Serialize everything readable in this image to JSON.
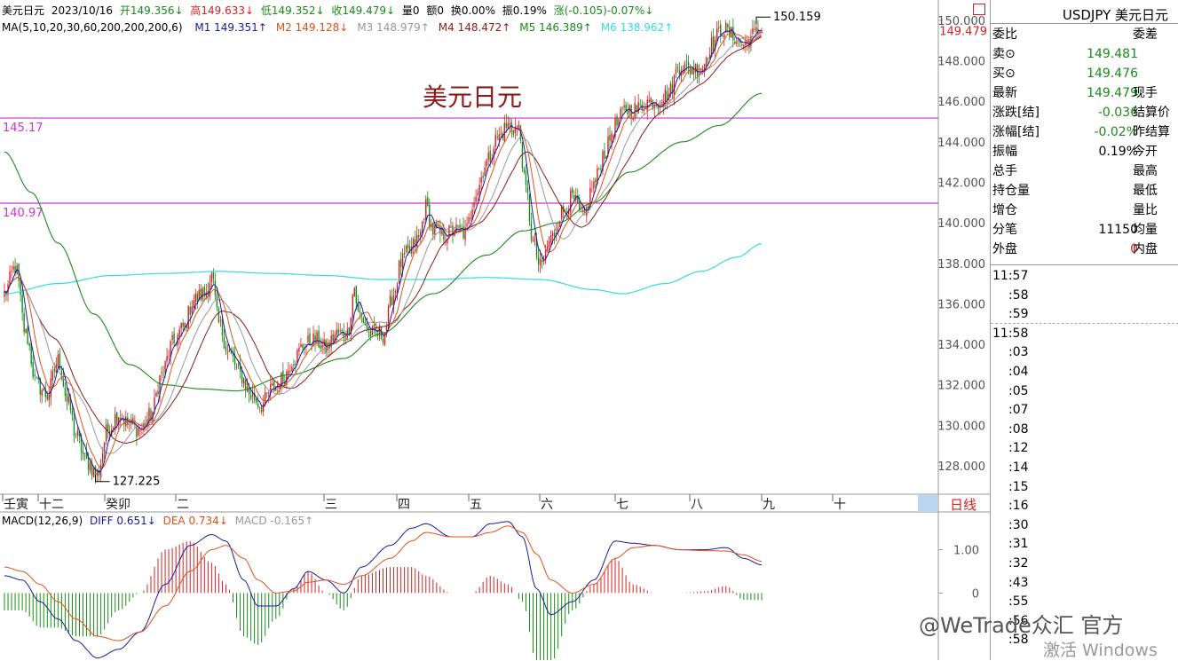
{
  "header": {
    "symbol_name": "美元日元",
    "date": "2023/10/16",
    "open": "开149.356↓",
    "high": "高149.633↓",
    "low": "低149.352↓",
    "close": "收149.479↓",
    "volume": "量0",
    "amount": "额0",
    "turnover": "换0.00%",
    "amplitude": "振0.19%",
    "change": "涨(-0.105)-0.07%↓"
  },
  "ma_legend": {
    "label": "MA(5,10,20,30,60,200,200,200,6)",
    "items": [
      {
        "text": "M1 149.351↑",
        "color": "#1a1aa0"
      },
      {
        "text": "M2 149.128↓",
        "color": "#e0501a"
      },
      {
        "text": "M3 148.979↑",
        "color": "#999999"
      },
      {
        "text": "M4 148.472↑",
        "color": "#8b1a1a"
      },
      {
        "text": "M5 146.389↑",
        "color": "#1a8a1a"
      },
      {
        "text": "M6 138.962↑",
        "color": "#33dddd"
      }
    ]
  },
  "chart_title_overlay": "美元日元",
  "hline_labels": [
    "145.17",
    "140.97"
  ],
  "max_label": "150.159",
  "min_label": "127.225",
  "last_price_label": "149.479",
  "period_label": "日线",
  "macd_legend": {
    "label": "MACD(12,26,9)",
    "diff": "DIFF 0.651↓",
    "dea": "DEA 0.734↓",
    "macd": "MACD -0.165↑"
  },
  "colors": {
    "up": "#d42020",
    "down": "#1a8a1a",
    "hline": "#cc33cc",
    "ma5": "#1a1aa0",
    "ma10": "#e0501a",
    "ma20": "#999999",
    "ma30": "#8b1a1a",
    "ma60": "#1a8a1a",
    "ma200": "#33dddd"
  },
  "right_panel": {
    "title": "USDJPY 美元日元",
    "rows": [
      {
        "label": "委比",
        "value": "",
        "right": "委差"
      },
      {
        "label": "卖⊙",
        "value": "149.481",
        "right": "",
        "color": "#1a8a1a"
      },
      {
        "label": "买⊙",
        "value": "149.476",
        "right": "",
        "color": "#1a8a1a"
      },
      {
        "label": "最新",
        "value": "149.479",
        "right": "现手",
        "color": "#1a8a1a"
      },
      {
        "label": "涨跌[结]",
        "value": "-0.036",
        "right": "结算价",
        "color": "#1a8a1a"
      },
      {
        "label": "涨幅[结]",
        "value": "-0.02%",
        "right": "昨结算",
        "color": "#1a8a1a"
      },
      {
        "label": "振幅",
        "value": "0.19%",
        "right": "今开",
        "color": "#000"
      },
      {
        "label": "总手",
        "value": "",
        "right": "最高"
      },
      {
        "label": "持仓量",
        "value": "",
        "right": "最低"
      },
      {
        "label": "增仓",
        "value": "",
        "right": "量比"
      },
      {
        "label": "分笔",
        "value": "11150",
        "right": "均量",
        "color": "#000"
      },
      {
        "label": "外盘",
        "value": "0",
        "right": "内盘",
        "color": "#d42020"
      }
    ],
    "ticks": [
      "11:57",
      ":58",
      ":59",
      "11:58",
      ":03",
      ":04",
      ":05",
      ":07",
      ":08",
      ":12",
      ":14",
      ":15",
      ":16",
      ":30",
      ":31",
      ":32",
      ":43",
      ":55",
      ":56",
      ":58"
    ]
  },
  "watermark": {
    "line1": "@WeTrade众汇 官方",
    "line2": "激活 Windows"
  },
  "chart_data": [
    {
      "type": "candlestick",
      "title": "美元日元",
      "y_axis_ticks": [
        "150.000",
        "148.000",
        "146.000",
        "144.000",
        "142.000",
        "140.000",
        "138.000",
        "136.000",
        "134.000",
        "132.000",
        "130.000",
        "128.000"
      ],
      "ylim": [
        126.6,
        151.0
      ],
      "x_axis_labels": [
        "壬寅",
        "十二",
        "癸卯",
        "二",
        "三",
        "四",
        "五",
        "六",
        "七",
        "八",
        "九",
        "十"
      ],
      "horizontal_lines": [
        145.17,
        140.97
      ],
      "max_point": 150.159,
      "min_point": 127.225,
      "anchors": [
        [
          0,
          136.5
        ],
        [
          6,
          137.8
        ],
        [
          12,
          134.5
        ],
        [
          18,
          132.0
        ],
        [
          24,
          131.5
        ],
        [
          30,
          133.2
        ],
        [
          36,
          131.0
        ],
        [
          40,
          129.5
        ],
        [
          46,
          128.2
        ],
        [
          52,
          127.6
        ],
        [
          58,
          129.8
        ],
        [
          64,
          130.6
        ],
        [
          70,
          130.0
        ],
        [
          76,
          129.8
        ],
        [
          82,
          130.5
        ],
        [
          88,
          132.5
        ],
        [
          94,
          134.0
        ],
        [
          100,
          134.8
        ],
        [
          106,
          136.2
        ],
        [
          112,
          136.5
        ],
        [
          116,
          137.3
        ],
        [
          120,
          135.0
        ],
        [
          126,
          133.5
        ],
        [
          132,
          132.5
        ],
        [
          138,
          131.5
        ],
        [
          144,
          131.0
        ],
        [
          150,
          131.8
        ],
        [
          156,
          132.3
        ],
        [
          162,
          133.3
        ],
        [
          168,
          134.0
        ],
        [
          174,
          134.2
        ],
        [
          180,
          133.8
        ],
        [
          186,
          134.5
        ],
        [
          192,
          134.5
        ],
        [
          196,
          136.8
        ],
        [
          198,
          135.5
        ],
        [
          206,
          134.5
        ],
        [
          212,
          134.5
        ],
        [
          218,
          136.5
        ],
        [
          222,
          138.0
        ],
        [
          226,
          138.5
        ],
        [
          232,
          139.2
        ],
        [
          236,
          140.8
        ],
        [
          240,
          139.6
        ],
        [
          246,
          139.4
        ],
        [
          252,
          139.6
        ],
        [
          258,
          139.5
        ],
        [
          264,
          141.5
        ],
        [
          270,
          143.0
        ],
        [
          276,
          144.2
        ],
        [
          282,
          144.8
        ],
        [
          288,
          144.6
        ],
        [
          292,
          141.6
        ],
        [
          296,
          139.0
        ],
        [
          300,
          137.8
        ],
        [
          306,
          139.2
        ],
        [
          312,
          140.5
        ],
        [
          318,
          141.2
        ],
        [
          324,
          140.2
        ],
        [
          330,
          141.9
        ],
        [
          336,
          143.5
        ],
        [
          342,
          144.8
        ],
        [
          348,
          145.6
        ],
        [
          354,
          145.6
        ],
        [
          360,
          146.0
        ],
        [
          366,
          146.0
        ],
        [
          372,
          146.4
        ],
        [
          378,
          147.8
        ],
        [
          384,
          147.6
        ],
        [
          390,
          147.6
        ],
        [
          396,
          148.8
        ],
        [
          402,
          149.6
        ],
        [
          408,
          149.2
        ],
        [
          414,
          148.8
        ],
        [
          420,
          149.3
        ],
        [
          424,
          149.48
        ]
      ],
      "ma200_anchors": [
        [
          0,
          136.5
        ],
        [
          30,
          137.0
        ],
        [
          60,
          137.4
        ],
        [
          90,
          137.5
        ],
        [
          120,
          137.6
        ],
        [
          150,
          137.5
        ],
        [
          180,
          137.4
        ],
        [
          210,
          137.2
        ],
        [
          240,
          137.2
        ],
        [
          270,
          137.3
        ],
        [
          300,
          137.2
        ],
        [
          330,
          136.7
        ],
        [
          346,
          136.5
        ],
        [
          370,
          137.0
        ],
        [
          390,
          137.6
        ],
        [
          410,
          138.3
        ],
        [
          424,
          138.962
        ]
      ],
      "ma60_anchors": [
        [
          0,
          143.5
        ],
        [
          15,
          141.5
        ],
        [
          30,
          139.0
        ],
        [
          50,
          135.5
        ],
        [
          70,
          133.0
        ],
        [
          90,
          132.0
        ],
        [
          110,
          131.8
        ],
        [
          130,
          131.7
        ],
        [
          160,
          132.5
        ],
        [
          190,
          133.3
        ],
        [
          210,
          134.5
        ],
        [
          240,
          136.5
        ],
        [
          270,
          138.4
        ],
        [
          290,
          139.6
        ],
        [
          310,
          140.0
        ],
        [
          330,
          141.0
        ],
        [
          350,
          142.5
        ],
        [
          380,
          144.0
        ],
        [
          400,
          144.8
        ],
        [
          424,
          146.389
        ]
      ]
    },
    {
      "type": "bar",
      "title": "MACD(12,26,9)",
      "y_axis_ticks": [
        "1.00",
        "0"
      ],
      "ylim": [
        -1.55,
        1.75
      ],
      "diff_anchors": [
        [
          0,
          0.4
        ],
        [
          10,
          0.3
        ],
        [
          20,
          -0.2
        ],
        [
          30,
          -0.6
        ],
        [
          40,
          -1.1
        ],
        [
          52,
          -1.5
        ],
        [
          64,
          -1.3
        ],
        [
          76,
          -0.9
        ],
        [
          90,
          0.2
        ],
        [
          104,
          1.1
        ],
        [
          116,
          1.35
        ],
        [
          124,
          1.2
        ],
        [
          134,
          0.3
        ],
        [
          142,
          -0.3
        ],
        [
          152,
          -0.3
        ],
        [
          162,
          0.1
        ],
        [
          170,
          0.5
        ],
        [
          180,
          0.3
        ],
        [
          190,
          0.0
        ],
        [
          200,
          0.6
        ],
        [
          216,
          1.1
        ],
        [
          228,
          1.5
        ],
        [
          236,
          1.6
        ],
        [
          250,
          1.3
        ],
        [
          262,
          1.3
        ],
        [
          272,
          1.6
        ],
        [
          282,
          1.65
        ],
        [
          290,
          1.3
        ],
        [
          298,
          0.1
        ],
        [
          306,
          -0.5
        ],
        [
          318,
          -0.2
        ],
        [
          330,
          0.3
        ],
        [
          342,
          1.2
        ],
        [
          352,
          1.15
        ],
        [
          364,
          1.1
        ],
        [
          378,
          1.0
        ],
        [
          392,
          1.0
        ],
        [
          404,
          1.05
        ],
        [
          414,
          0.8
        ],
        [
          424,
          0.651
        ]
      ],
      "dea_anchors": [
        [
          0,
          0.6
        ],
        [
          10,
          0.5
        ],
        [
          20,
          0.2
        ],
        [
          30,
          -0.2
        ],
        [
          40,
          -0.6
        ],
        [
          52,
          -1.0
        ],
        [
          64,
          -1.1
        ],
        [
          76,
          -0.9
        ],
        [
          90,
          -0.3
        ],
        [
          104,
          0.5
        ],
        [
          116,
          1.0
        ],
        [
          124,
          1.1
        ],
        [
          134,
          0.8
        ],
        [
          142,
          0.3
        ],
        [
          152,
          0.0
        ],
        [
          162,
          0.05
        ],
        [
          170,
          0.25
        ],
        [
          180,
          0.3
        ],
        [
          190,
          0.2
        ],
        [
          200,
          0.4
        ],
        [
          216,
          0.8
        ],
        [
          228,
          1.2
        ],
        [
          236,
          1.4
        ],
        [
          250,
          1.3
        ],
        [
          262,
          1.3
        ],
        [
          272,
          1.4
        ],
        [
          282,
          1.55
        ],
        [
          290,
          1.4
        ],
        [
          298,
          0.9
        ],
        [
          306,
          0.3
        ],
        [
          318,
          0.0
        ],
        [
          330,
          0.2
        ],
        [
          342,
          0.8
        ],
        [
          352,
          1.05
        ],
        [
          364,
          1.1
        ],
        [
          378,
          1.0
        ],
        [
          392,
          0.98
        ],
        [
          404,
          0.97
        ],
        [
          414,
          0.88
        ],
        [
          424,
          0.734
        ]
      ]
    }
  ]
}
